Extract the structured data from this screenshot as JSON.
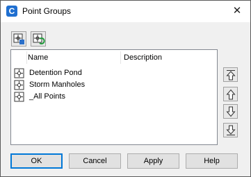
{
  "window": {
    "title": "Point Groups"
  },
  "icons": {
    "app": "civil3d-app-icon",
    "close": "close-icon",
    "properties": "point-group-properties-icon",
    "update": "point-group-update-icon"
  },
  "list": {
    "columns": [
      "Name",
      "Description"
    ],
    "rows": [
      {
        "name": "Detention Pond",
        "description": ""
      },
      {
        "name": "Storm Manholes",
        "description": ""
      },
      {
        "name": "_All Points",
        "description": ""
      }
    ]
  },
  "order_buttons": [
    "move-to-top",
    "move-up",
    "move-down",
    "move-to-bottom"
  ],
  "buttons": {
    "ok": "OK",
    "cancel": "Cancel",
    "apply": "Apply",
    "help": "Help"
  },
  "colors": {
    "accent": "#0078d7",
    "list_border": "#828790",
    "button_face": "#e1e1e1",
    "dialog_bg": "#f0f0f0"
  }
}
